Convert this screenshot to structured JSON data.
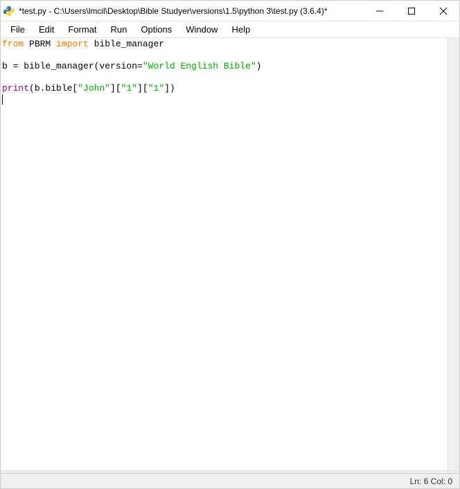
{
  "titlebar": {
    "title": "*test.py - C:\\Users\\lmcil\\Desktop\\Bible Studyer\\versions\\1.5\\python 3\\test.py (3.6.4)*"
  },
  "menubar": {
    "items": [
      {
        "label": "File"
      },
      {
        "label": "Edit"
      },
      {
        "label": "Format"
      },
      {
        "label": "Run"
      },
      {
        "label": "Options"
      },
      {
        "label": "Window"
      },
      {
        "label": "Help"
      }
    ]
  },
  "code": {
    "line1_kw1": "from",
    "line1_mod": " PBRM ",
    "line1_kw2": "import",
    "line1_name": " bible_manager",
    "line3_pre": "b = bible_manager(version=",
    "line3_str": "\"World English Bible\"",
    "line3_post": ")",
    "line5_fn": "print",
    "line5_a": "(b.bible[",
    "line5_s1": "\"John\"",
    "line5_b": "][",
    "line5_s2": "\"1\"",
    "line5_c": "][",
    "line5_s3": "\"1\"",
    "line5_d": "])"
  },
  "status": {
    "position": "Ln: 6  Col: 0"
  }
}
